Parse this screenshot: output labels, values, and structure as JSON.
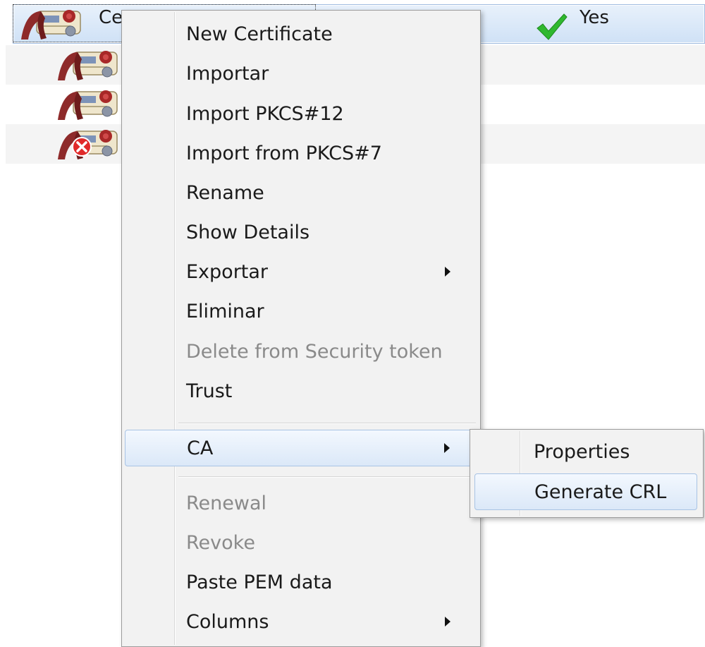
{
  "list": {
    "selected_row_text": "Ce",
    "trusted_value": "Yes"
  },
  "context_menu": {
    "items": [
      {
        "label": "New Certificate",
        "enabled": true
      },
      {
        "label": "Importar",
        "enabled": true
      },
      {
        "label": "Import PKCS#12",
        "enabled": true
      },
      {
        "label": "Import from PKCS#7",
        "enabled": true
      },
      {
        "label": "Rename",
        "enabled": true
      },
      {
        "label": "Show Details",
        "enabled": true
      },
      {
        "label": "Exportar",
        "enabled": true,
        "submenu": true
      },
      {
        "label": "Eliminar",
        "enabled": true
      },
      {
        "label": "Delete from Security token",
        "enabled": false
      },
      {
        "label": "Trust",
        "enabled": true
      },
      {
        "label": "CA",
        "enabled": true,
        "submenu": true,
        "highlighted": true
      },
      {
        "label": "Renewal",
        "enabled": false
      },
      {
        "label": "Revoke",
        "enabled": false
      },
      {
        "label": "Paste PEM data",
        "enabled": true
      },
      {
        "label": "Columns",
        "enabled": true,
        "submenu": true
      }
    ]
  },
  "ca_submenu": {
    "items": [
      {
        "label": "Properties",
        "enabled": true
      },
      {
        "label": "Generate CRL",
        "enabled": true,
        "highlighted": true
      }
    ]
  },
  "icons": {
    "certificate": "certificate-icon",
    "revoked_certificate": "revoked-certificate-icon",
    "trusted": "green-checkmark-icon",
    "submenu_arrow": "submenu-arrow-icon"
  },
  "colors": {
    "selection": "#cfe1f6",
    "menu_background": "#f2f2f2",
    "menu_highlight": "#dbe8f8",
    "disabled_text": "#8a8a8a",
    "check_green": "#2fb82f"
  }
}
